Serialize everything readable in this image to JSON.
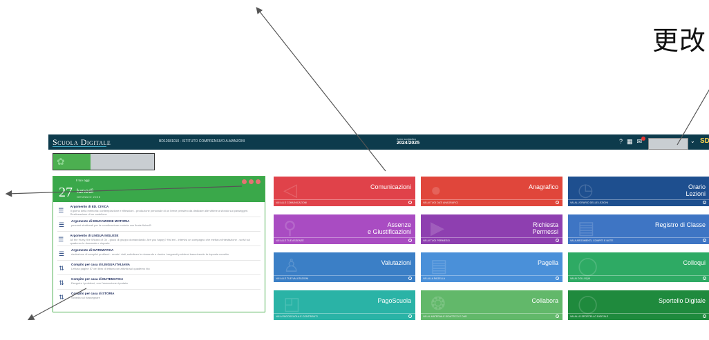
{
  "overlay": {
    "cjk_text": "更改"
  },
  "app": {
    "brand": "Scuola Digitale",
    "school": "BD12681010 - ISTITUTO COMPRENSIVO A.MANZONI",
    "year_label": "Anno scolastico",
    "year_value": "2024/2025",
    "help_icon": "help-icon",
    "calendar_icon": "calendar-icon",
    "mail_icon": "mail-icon",
    "sd_label": "SD"
  },
  "card": {
    "eyebrow": "Il tuo oggi",
    "day": "27",
    "weekday": "lunedì",
    "month": "GENNAIO 2025",
    "items": [
      {
        "icon": "list-icon",
        "title": "Argomento di ED. CIVICA",
        "desc": "Il giorno della memoria: contemplazione e riflessioni - produzione personale di un breve pensiero da dedicare alle vittime a sfondo sui passeggeri. Realizzazione di un cartellone"
      },
      {
        "icon": "list-icon",
        "title": "Argomento di EDUCAZIONE MOTORIA",
        "desc": "percorsi strutturati per la coordinazione motoria con finale fisica B"
      },
      {
        "icon": "list-icon",
        "title": "Argomento di LINGUA INGLESE",
        "desc": "All the Hurry, the Wizard of Oz - gioco di gruppo domandando: Are you happy? Hal eni - intervisi un compagno che metta un'intestazione - scrivi sul quaderno le domande e risposte"
      },
      {
        "icon": "list-icon",
        "title": "Argomento di MATEMATICA",
        "desc": "risoluzione di semplici problemi - rendo i dati, sottolineo le domande e risolvo i seguenti problemi trascrivendo la risposta corretta"
      },
      {
        "icon": "homework-icon",
        "title": "Compito per casa di LINGUA ITALIANA",
        "desc": "Lettura pagine 57 del libro di lettura con attività sul quaderno blu"
      },
      {
        "icon": "homework-icon",
        "title": "Compito per casa di MATEMATICA",
        "desc": "Eseguire i problemi, con l'esecuzione riportata"
      },
      {
        "icon": "homework-icon",
        "title": "Compito per casa di STORIA",
        "desc": "Scheda sul riassegnare"
      }
    ]
  },
  "tiles": [
    {
      "label": "Comunicazioni",
      "link": "VAI ALLE COMUNICAZIONI",
      "color": "#e0424a"
    },
    {
      "label": "Anagrafico",
      "link": "VAI AI TUOI DATI ANAGRAFICI",
      "color": "#e0463b"
    },
    {
      "label": "Orario\nLezioni",
      "link": "VAI ALL'ORARIO DELLE LEZIONI",
      "color": "#1e4f8f"
    },
    {
      "label": "Assenze\ne Giustificazioni",
      "link": "VAI ALLE TUE ASSENZE",
      "color": "#a94cc2"
    },
    {
      "label": "Richiesta\nPermessi",
      "link": "VAI AI TUOI PERMESSI",
      "color": "#8e3fb0"
    },
    {
      "label": "Registro di Classe",
      "link": "VAI A ARGOMENTI, COMPITI E NOTE",
      "color": "#3e75c4"
    },
    {
      "label": "Valutazioni",
      "link": "VAI ALLE TUE VALUTAZIONI",
      "color": "#3b7fc6"
    },
    {
      "label": "Pagella",
      "link": "VAI ALLA PAGELLA",
      "color": "#4a90d9"
    },
    {
      "label": "Colloqui",
      "link": "VAI AI COLLOQUI",
      "color": "#2eaa64"
    },
    {
      "label": "PagoScuola",
      "link": "VAI A PAGOSCUOLA E CONTRIBUTI",
      "color": "#2ab3a6"
    },
    {
      "label": "Collabora",
      "link": "VAI AL MATERIALE DIDATTICO E DAD",
      "color": "#62b86a"
    },
    {
      "label": "Sportello Digitale",
      "link": "VAI ALLO SPORTELLO DIGITALE",
      "color": "#1f8a3d"
    }
  ]
}
